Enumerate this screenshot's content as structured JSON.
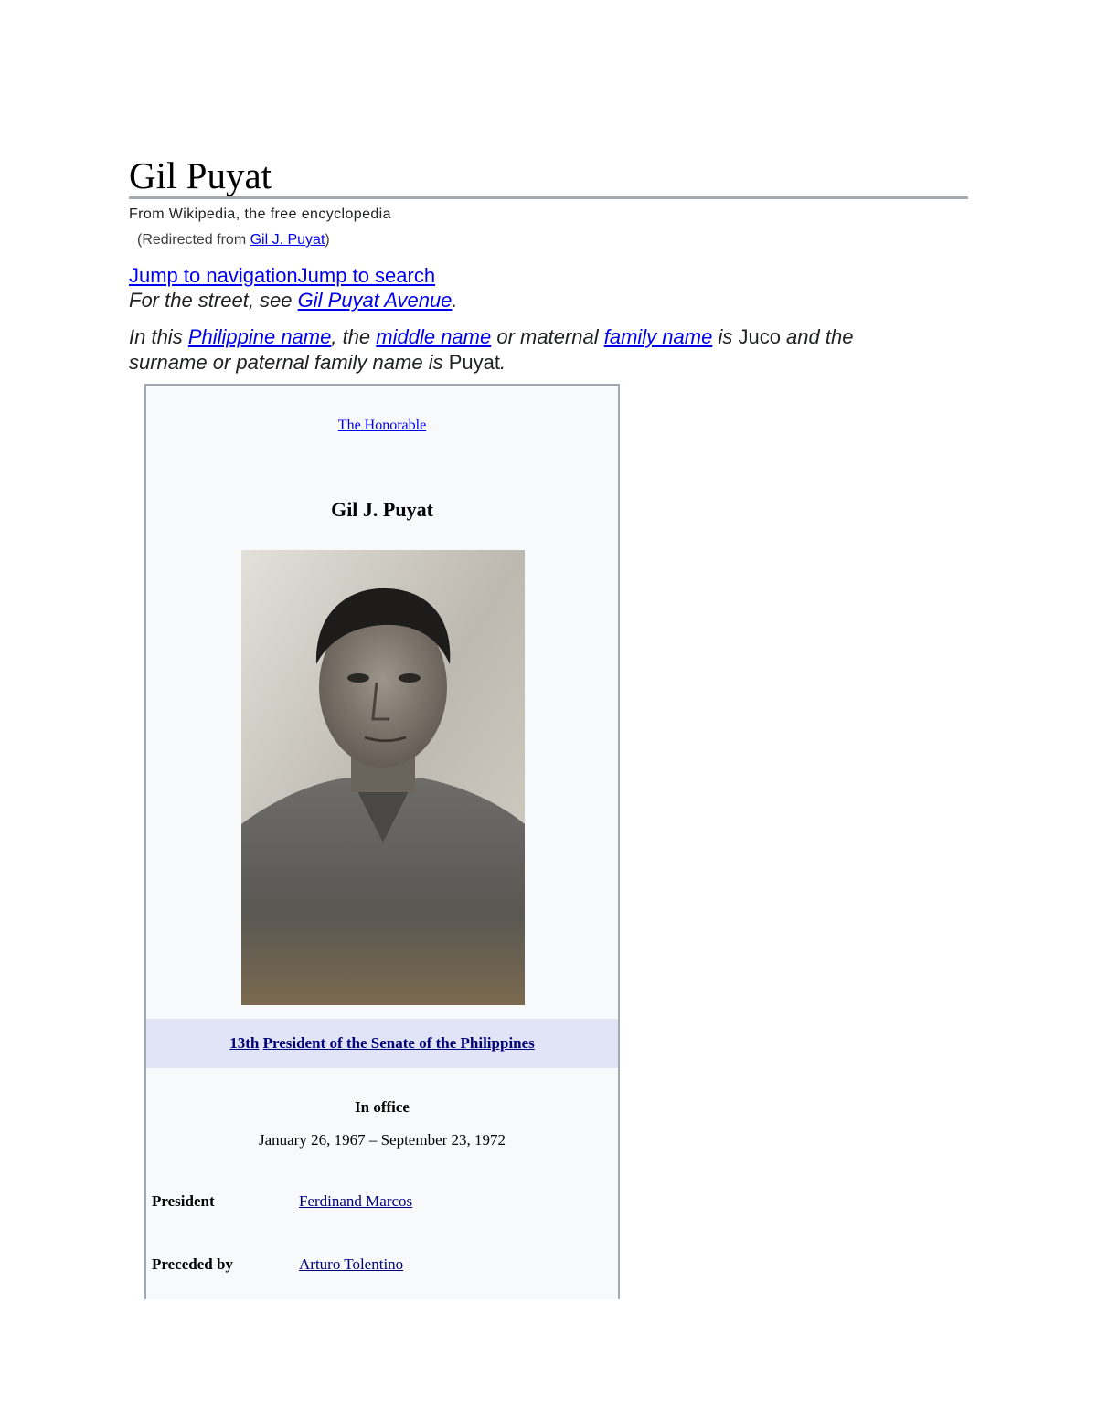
{
  "article": {
    "title": "Gil Puyat",
    "tagline": "From Wikipedia, the free encyclopedia",
    "redirect_prefix": "(Redirected from ",
    "redirect_link": "Gil J. Puyat",
    "redirect_suffix": ")",
    "jump_navigation": "Jump to navigation",
    "jump_search": "Jump to search",
    "hatnote_prefix": "For the street, see ",
    "hatnote_link": "Gil Puyat Avenue",
    "hatnote_suffix": ".",
    "namenote": {
      "part1": "In this ",
      "link1": "Philippine name",
      "part2": ", the ",
      "link2": "middle name",
      "part3": " or maternal ",
      "link3": "family name",
      "part4": " is ",
      "middle": "Juco",
      "part5": " and the surname or paternal family name is ",
      "surname": "Puyat",
      "part6": "."
    }
  },
  "infobox": {
    "honorific": "The Honorable",
    "name": "Gil J. Puyat",
    "office_ordinal": "13th",
    "office_title": "President of the Senate of the Philippines",
    "in_office_label": "In office",
    "office_dates": "January 26, 1967 – September 23, 1972",
    "rows": [
      {
        "label": "President",
        "value": "Ferdinand Marcos"
      },
      {
        "label": "Preceded by",
        "value": "Arturo Tolentino"
      }
    ]
  }
}
